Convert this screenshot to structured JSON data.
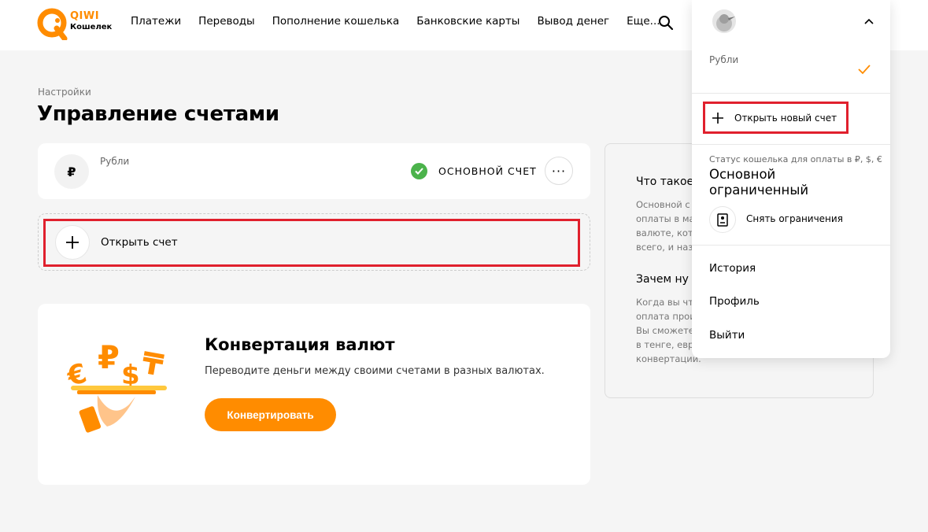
{
  "header": {
    "brand": "QIWI",
    "brand_sub": "Кошелек",
    "nav": [
      "Платежи",
      "Переводы",
      "Пополнение кошелька",
      "Банковские карты",
      "Вывод денег",
      "Еще..."
    ]
  },
  "breadcrumb": "Настройки",
  "page_title": "Управление счетами",
  "account": {
    "currency_symbol": "₽",
    "name": "Рубли",
    "badge": "ОСНОВНОЙ СЧЕТ",
    "more": "···"
  },
  "open_account": {
    "label": "Открыть счет"
  },
  "conversion": {
    "title": "Конвертация валют",
    "description": "Переводите деньги между своими счетами в разных валютах.",
    "button": "Конвертировать"
  },
  "info": {
    "heading1": "Что такое",
    "para1": [
      "Основной с",
      "оплаты в ма",
      "валюте, кот",
      "всего, и наз"
    ],
    "heading2": "Зачем ну",
    "para2": [
      "Когда вы что",
      "оплата прои",
      "Вы сможете",
      "в тенге, евро",
      "конвертации."
    ]
  },
  "dropdown": {
    "account_name": "Рубли",
    "open_new": "Открыть новый счет",
    "status_caption": "Статус кошелька для оплаты в ₽, $, €",
    "status_value": "Основной ограниченный",
    "lift_restrictions": "Снять ограничения",
    "links": [
      "История",
      "Профиль",
      "Выйти"
    ]
  },
  "colors": {
    "accent": "#ff8c00",
    "highlight": "#e0202d",
    "success": "#4bb34b"
  }
}
